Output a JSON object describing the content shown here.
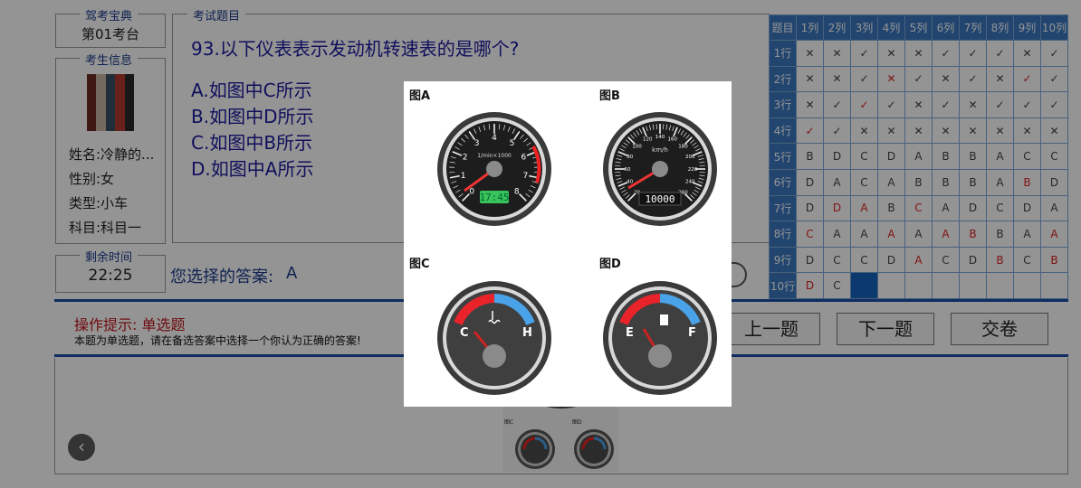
{
  "brand": {
    "title": "驾考宝典",
    "seat": "第01考台"
  },
  "student": {
    "legend": "考生信息",
    "name": "姓名:冷静的...",
    "gender": "性别:女",
    "type": "类型:小车",
    "subject": "科目:科目一",
    "avatar_colors": [
      "#6b2b23",
      "#c9b6a4",
      "#3c4f65",
      "#b33a2d",
      "#2a2a2a"
    ]
  },
  "time": {
    "legend": "剩余时间",
    "value": "22:25"
  },
  "question": {
    "legend": "考试题目",
    "text": "93.以下仪表表示发动机转速表的是哪个?",
    "options": [
      "A.如图中C所示",
      "B.如图中D所示",
      "C.如图中B所示",
      "D.如图中A所示"
    ]
  },
  "answer": {
    "label": "您选择的答案:",
    "value": "A"
  },
  "grid": {
    "corner": "题目",
    "cols": [
      "1列",
      "2列",
      "3列",
      "4列",
      "5列",
      "6列",
      "7列",
      "8列",
      "9列",
      "10列"
    ],
    "rows": [
      {
        "label": "1行",
        "cells": [
          "✕",
          "✕",
          "✓",
          "✕",
          "✕",
          "✓",
          "✓",
          "✓",
          "✕",
          "✓"
        ],
        "red": []
      },
      {
        "label": "2行",
        "cells": [
          "✕",
          "✕",
          "✓",
          "✕",
          "✓",
          "✕",
          "✓",
          "✕",
          "✓",
          "✓"
        ],
        "red": [
          3,
          8
        ]
      },
      {
        "label": "3行",
        "cells": [
          "✕",
          "✓",
          "✓",
          "✓",
          "✕",
          "✓",
          "✕",
          "✓",
          "✓",
          "✓"
        ],
        "red": [
          2
        ]
      },
      {
        "label": "4行",
        "cells": [
          "✓",
          "✓",
          "✕",
          "✕",
          "✕",
          "✕",
          "✕",
          "✕",
          "✕",
          "✕"
        ],
        "red": [
          0
        ]
      },
      {
        "label": "5行",
        "cells": [
          "B",
          "D",
          "C",
          "D",
          "A",
          "B",
          "B",
          "A",
          "C",
          "C"
        ],
        "red": []
      },
      {
        "label": "6行",
        "cells": [
          "D",
          "A",
          "C",
          "A",
          "B",
          "B",
          "B",
          "A",
          "B",
          "D"
        ],
        "red": [
          8
        ]
      },
      {
        "label": "7行",
        "cells": [
          "D",
          "D",
          "A",
          "B",
          "C",
          "A",
          "D",
          "C",
          "D",
          "A"
        ],
        "red": [
          1,
          2,
          4
        ]
      },
      {
        "label": "8行",
        "cells": [
          "C",
          "A",
          "A",
          "A",
          "A",
          "A",
          "B",
          "B",
          "A",
          "A"
        ],
        "red": [
          0,
          3,
          5,
          6,
          9
        ]
      },
      {
        "label": "9行",
        "cells": [
          "D",
          "C",
          "C",
          "D",
          "A",
          "C",
          "D",
          "B",
          "C",
          "B"
        ],
        "red": [
          4,
          7,
          9
        ]
      },
      {
        "label": "10行",
        "cells": [
          "D",
          "C",
          "",
          "",
          "",
          "",
          "",
          "",
          "",
          ""
        ],
        "red": [
          0
        ],
        "current": 2
      }
    ]
  },
  "tips": {
    "title": "操作提示: 单选题",
    "body": "本题为单选题，请在备选答案中选择一个你认为正确的答案!"
  },
  "buttons": {
    "prev": "上一题",
    "next": "下一题",
    "submit": "交卷"
  },
  "popup": {
    "labels": [
      "图A",
      "图B",
      "图C",
      "图D"
    ],
    "gauge_a": {
      "ticks": [
        "0",
        "1",
        "2",
        "3",
        "4",
        "5",
        "6",
        "7",
        "8"
      ],
      "unit": "1/min×1000",
      "clock": "17:45"
    },
    "gauge_b": {
      "ticks": [
        "20",
        "40",
        "60",
        "80",
        "100",
        "120",
        "140",
        "160",
        "180",
        "200",
        "220",
        "240",
        "260"
      ],
      "unit": "km/h",
      "odometer": "10000"
    },
    "gauge_c": {
      "low": "C",
      "high": "H"
    },
    "gauge_d": {
      "low": "E",
      "high": "F"
    }
  },
  "thumb": {
    "labels": [
      "图C",
      "图D"
    ]
  },
  "colors": {
    "accent": "#1b4fa8",
    "grid_header": "#3b78c0",
    "question_text": "#1a1aa0",
    "warn": "#c0161b"
  }
}
